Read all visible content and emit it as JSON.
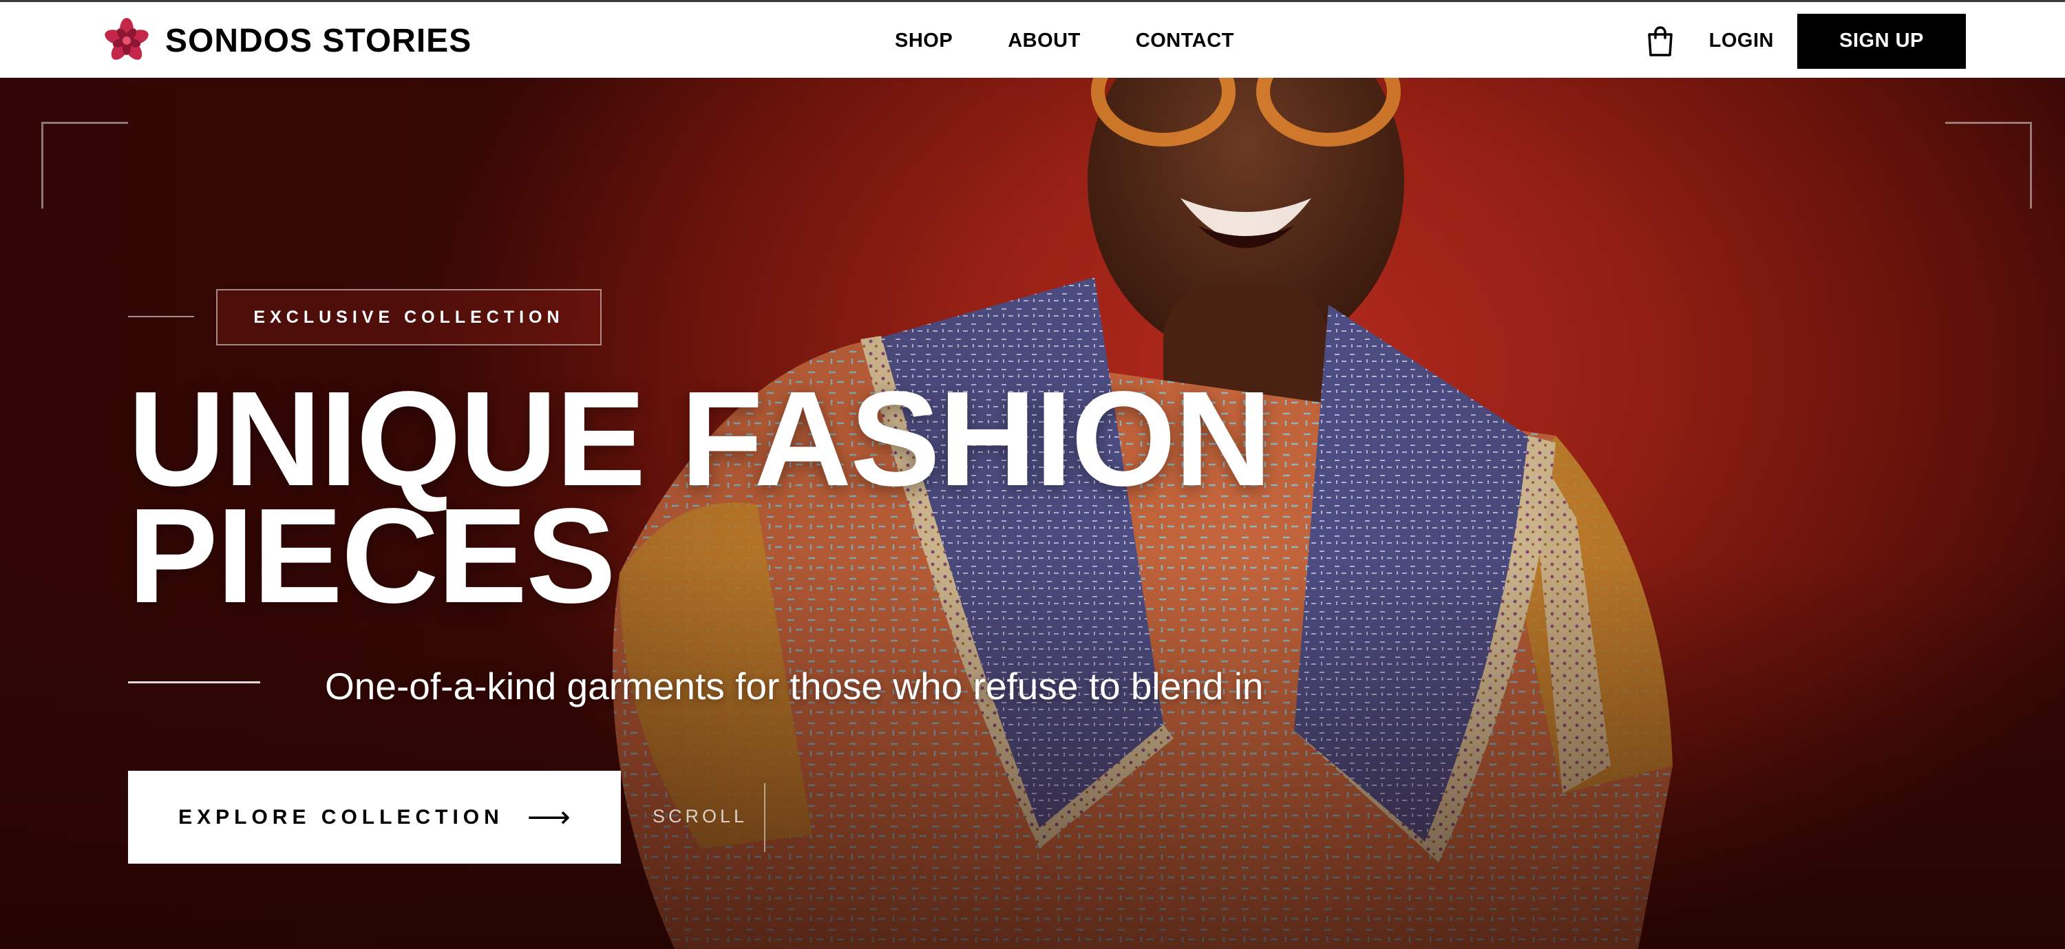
{
  "brand": {
    "name": "SONDOS STORIES",
    "logo_icon": "flower-logo-icon",
    "logo_color": "#c3284a"
  },
  "nav": {
    "links": [
      {
        "label": "SHOP"
      },
      {
        "label": "ABOUT"
      },
      {
        "label": "CONTACT"
      }
    ],
    "cart_icon": "shopping-bag-icon",
    "login_label": "LOGIN",
    "signup_label": "SIGN UP"
  },
  "hero": {
    "badge": "EXCLUSIVE COLLECTION",
    "headline_line1": "UNIQUE FASHION",
    "headline_line2": "PIECES",
    "subtitle": "One-of-a-kind garments for those who refuse to blend in",
    "cta_label": "EXPLORE COLLECTION",
    "cta_icon": "arrow-right-icon",
    "scroll_label": "SCROLL",
    "background_color": "#9e2216"
  }
}
